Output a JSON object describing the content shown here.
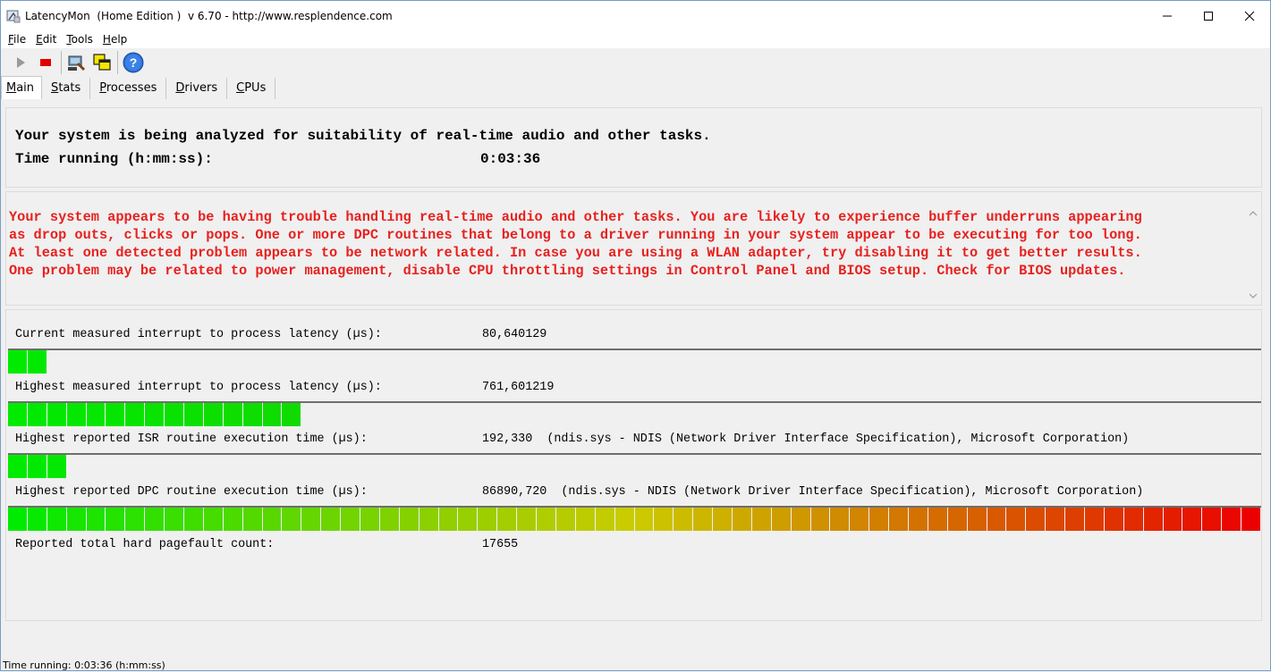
{
  "window": {
    "title": "LatencyMon  (Home Edition )  v 6.70 - http://www.resplendence.com",
    "minimize": "minimize",
    "maximize": "maximize",
    "close": "close"
  },
  "menu": [
    {
      "key": "F",
      "rest": "ile"
    },
    {
      "key": "E",
      "rest": "dit"
    },
    {
      "key": "T",
      "rest": "ools"
    },
    {
      "key": "H",
      "rest": "elp"
    }
  ],
  "toolbar": {
    "icons": [
      "play-icon",
      "stop-icon",
      "analyze-tool-icon",
      "windows-icon",
      "help-icon"
    ]
  },
  "tabs": [
    {
      "key": "M",
      "rest": "ain",
      "active": true
    },
    {
      "key": "S",
      "rest": "tats",
      "active": false
    },
    {
      "key": "P",
      "rest": "rocesses",
      "active": false
    },
    {
      "key": "D",
      "rest": "rivers",
      "active": false
    },
    {
      "key": "C",
      "rest": "PUs",
      "active": false
    }
  ],
  "status": {
    "line1": "Your system is being analyzed for suitability of real-time audio and other tasks.",
    "time_label": "Time running (h:mm:ss):",
    "time_value": "0:03:36"
  },
  "message": {
    "text": "Your system appears to be having trouble handling real-time audio and other tasks. You are likely to experience buffer underruns appearing\nas drop outs, clicks or pops. One or more DPC routines that belong to a driver running in your system appear to be executing for too long.\nAt least one detected problem appears to be network related. In case you are using a WLAN adapter, try disabling it to get better results.\nOne problem may be related to power management, disable CPU throttling settings in Control Panel and BIOS setup. Check for BIOS updates.",
    "color": "#e8201e"
  },
  "metrics": [
    {
      "label": "Current measured interrupt to process latency (µs):",
      "value": "80,640129",
      "segments": 2
    },
    {
      "label": "Highest measured interrupt to process latency (µs):",
      "value": "761,601219",
      "segments": 15
    },
    {
      "label": "Highest reported ISR routine execution time (µs):",
      "value": "192,330  (ndis.sys - NDIS (Network Driver Interface Specification), Microsoft Corporation)",
      "segments": 3
    },
    {
      "label": "Highest reported DPC routine execution time (µs):",
      "value": "86890,720  (ndis.sys - NDIS (Network Driver Interface Specification), Microsoft Corporation)",
      "segments": 64
    },
    {
      "label": "Reported total hard pagefault count:",
      "value": "17655",
      "segments": 0
    }
  ],
  "statusbar": {
    "text": "Time running: 0:03:36  (h:mm:ss)"
  }
}
